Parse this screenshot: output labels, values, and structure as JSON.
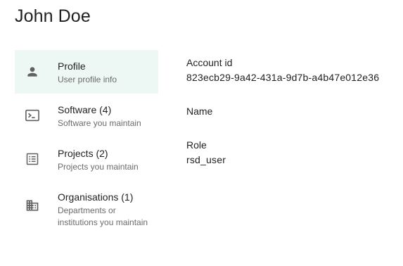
{
  "header": {
    "title": "John Doe"
  },
  "sidebar": {
    "items": [
      {
        "label": "Profile",
        "subtitle": "User profile info",
        "icon": "person-icon",
        "active": true
      },
      {
        "label": "Software (4)",
        "subtitle": "Software you maintain",
        "icon": "terminal-icon",
        "active": false
      },
      {
        "label": "Projects (2)",
        "subtitle": "Projects you maintain",
        "icon": "list-icon",
        "active": false
      },
      {
        "label": "Organisations (1)",
        "subtitle": "Departments or institutions you maintain",
        "icon": "building-icon",
        "active": false
      }
    ]
  },
  "profile": {
    "account_id_label": "Account id",
    "account_id_value": "823ecb29-9a42-431a-9d7b-a4b47e012e36",
    "name_label": "Name",
    "name_value": "",
    "role_label": "Role",
    "role_value": "rsd_user"
  },
  "colors": {
    "active_background": "#edf7f3",
    "icon": "#616161",
    "subtitle": "#6b6b6b"
  }
}
